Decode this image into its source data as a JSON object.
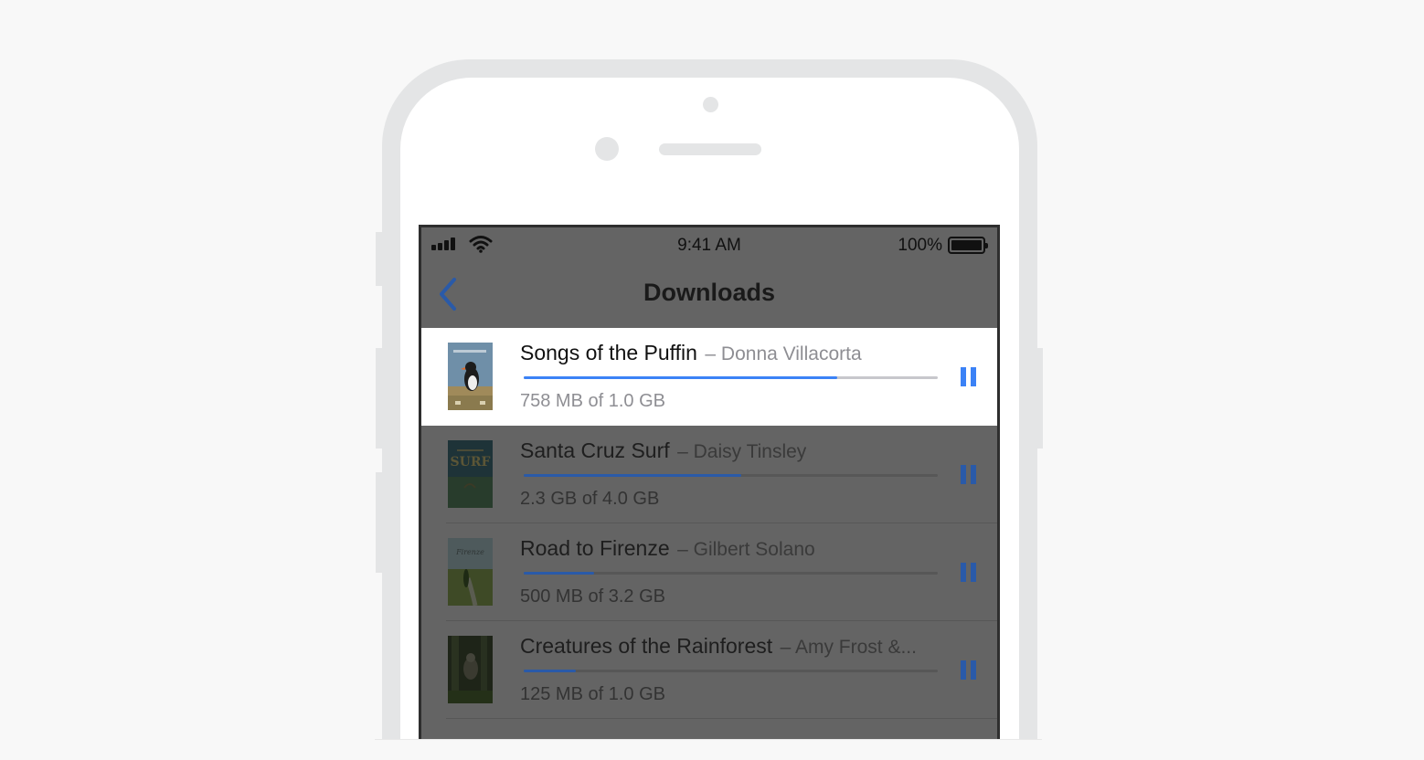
{
  "status_bar": {
    "time": "9:41 AM",
    "battery_percent": "100%",
    "signal_icon": "cellular-signal-icon",
    "wifi_icon": "wifi-icon",
    "battery_icon": "battery-full-icon"
  },
  "nav": {
    "title": "Downloads",
    "back_icon": "chevron-left-icon"
  },
  "colors": {
    "accent": "#3b82f6",
    "overlay": "#646464",
    "progress_track": "#c7c7cc",
    "secondary_text": "#8e8e93"
  },
  "downloads": [
    {
      "title": "Songs of the Puffin",
      "author": "– Donna Villacorta",
      "size_text": "758 MB of 1.0 GB",
      "progress": 0.758,
      "active": true,
      "poster_icon": "puffin-poster-icon",
      "action_icon": "pause-icon"
    },
    {
      "title": "Santa Cruz Surf",
      "author": "– Daisy Tinsley",
      "size_text": "2.3 GB of 4.0 GB",
      "progress": 0.525,
      "active": false,
      "poster_icon": "surf-poster-icon",
      "action_icon": "pause-icon"
    },
    {
      "title": "Road to Firenze",
      "author": "– Gilbert Solano",
      "size_text": "500 MB of 3.2 GB",
      "progress": 0.17,
      "active": false,
      "poster_icon": "firenze-poster-icon",
      "action_icon": "pause-icon"
    },
    {
      "title": "Creatures of the Rainforest",
      "author": "– Amy Frost &...",
      "size_text": "125 MB of 1.0 GB",
      "progress": 0.125,
      "active": false,
      "poster_icon": "rainforest-poster-icon",
      "action_icon": "pause-icon"
    }
  ]
}
